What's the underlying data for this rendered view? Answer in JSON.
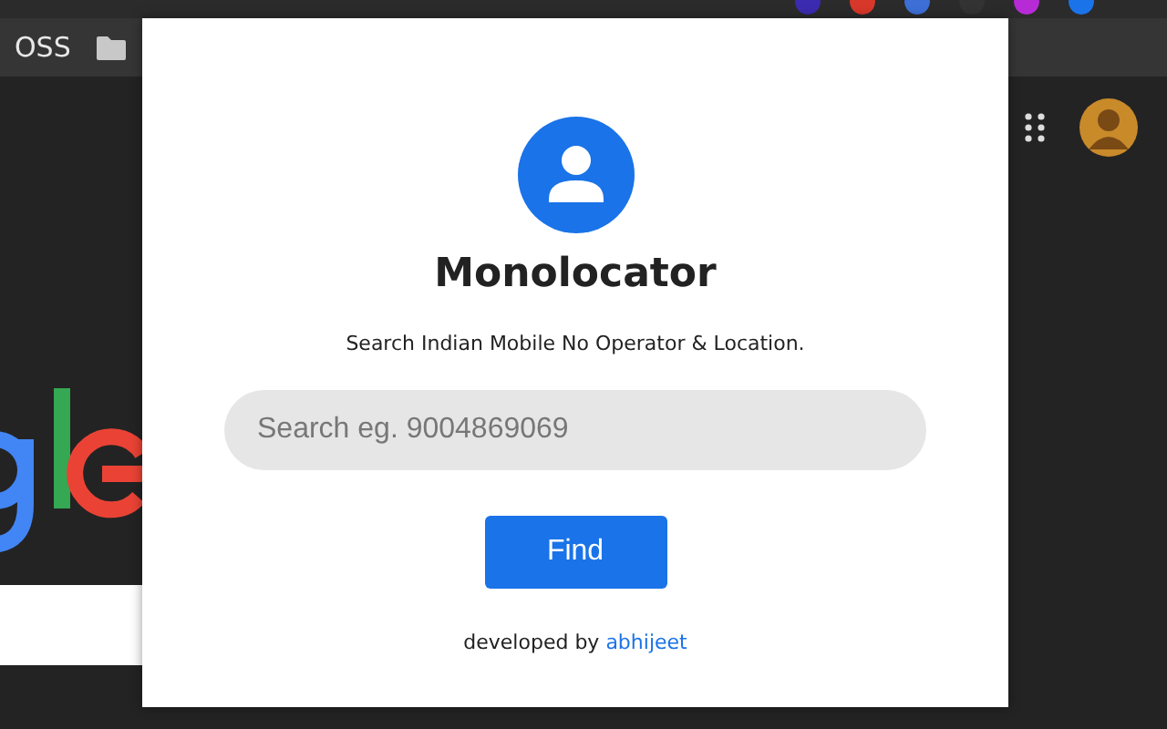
{
  "bookmarks_bar": {
    "items": [
      {
        "label": "OSS"
      }
    ]
  },
  "popup": {
    "title": "Monolocator",
    "subtitle": "Search Indian Mobile No Operator & Location.",
    "search": {
      "placeholder": "Search eg. 9004869069"
    },
    "button": "Find",
    "credit": "developed by",
    "credit_link": "abhijeet"
  }
}
